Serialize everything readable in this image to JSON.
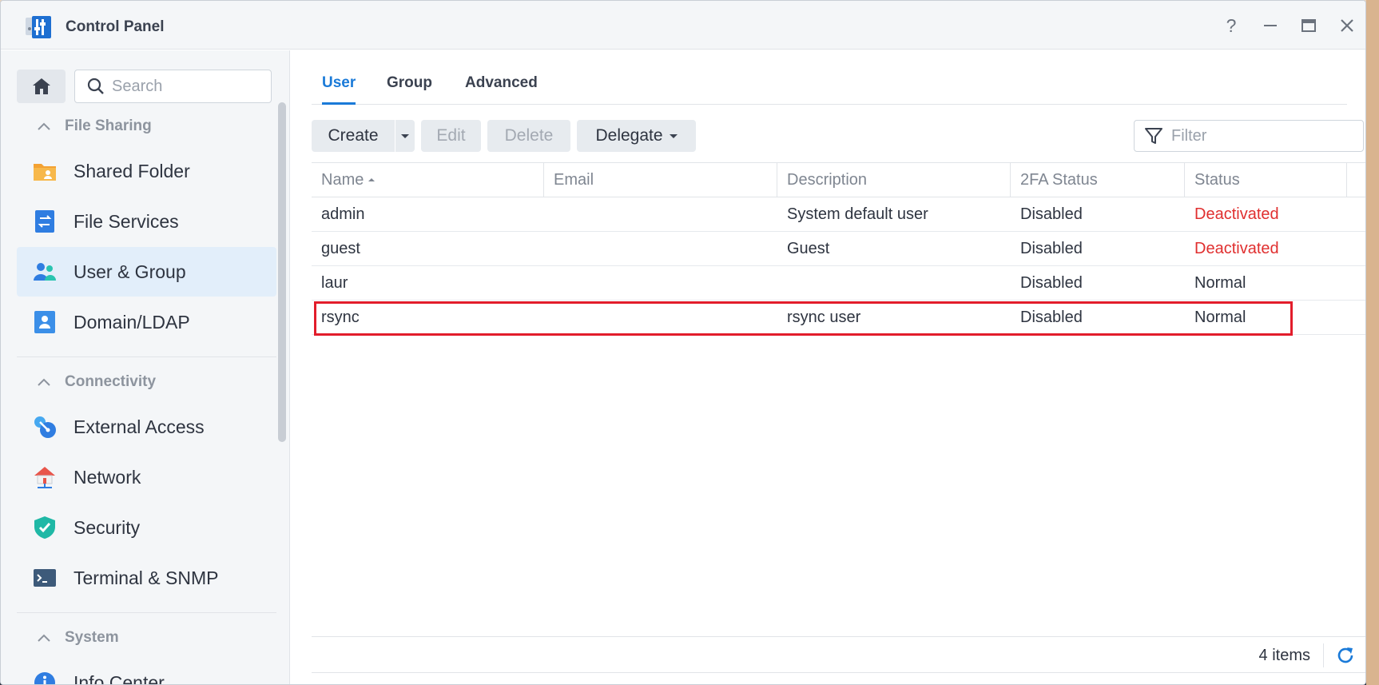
{
  "window": {
    "title": "Control Panel",
    "controls": [
      "help",
      "minimize",
      "maximize",
      "close"
    ]
  },
  "sidebar": {
    "search_placeholder": "Search",
    "sections": [
      {
        "title": "File Sharing",
        "items": [
          {
            "label": "Shared Folder",
            "icon": "folder-icon"
          },
          {
            "label": "File Services",
            "icon": "file-services-icon"
          },
          {
            "label": "User & Group",
            "icon": "users-icon",
            "active": true
          },
          {
            "label": "Domain/LDAP",
            "icon": "ldap-icon"
          }
        ]
      },
      {
        "title": "Connectivity",
        "items": [
          {
            "label": "External Access",
            "icon": "external-access-icon"
          },
          {
            "label": "Network",
            "icon": "network-icon"
          },
          {
            "label": "Security",
            "icon": "shield-icon"
          },
          {
            "label": "Terminal & SNMP",
            "icon": "terminal-icon"
          }
        ]
      },
      {
        "title": "System",
        "items": [
          {
            "label": "Info Center",
            "icon": "info-icon"
          }
        ]
      }
    ]
  },
  "main": {
    "tabs": [
      {
        "label": "User",
        "active": true
      },
      {
        "label": "Group"
      },
      {
        "label": "Advanced"
      }
    ],
    "toolbar": {
      "create": "Create",
      "edit": "Edit",
      "delete": "Delete",
      "delegate": "Delegate",
      "filter_placeholder": "Filter"
    },
    "table": {
      "columns": [
        "Name",
        "Email",
        "Description",
        "2FA Status",
        "Status"
      ],
      "sort_column": "Name",
      "rows": [
        {
          "name": "admin",
          "email": "",
          "description": "System default user",
          "twofa": "Disabled",
          "status": "Deactivated"
        },
        {
          "name": "guest",
          "email": "",
          "description": "Guest",
          "twofa": "Disabled",
          "status": "Deactivated"
        },
        {
          "name": "laur",
          "email": "",
          "description": "",
          "twofa": "Disabled",
          "status": "Normal"
        },
        {
          "name": "rsync",
          "email": "",
          "description": "rsync user",
          "twofa": "Disabled",
          "status": "Normal",
          "highlighted": true
        }
      ]
    },
    "footer": {
      "count": "4 items"
    }
  },
  "colors": {
    "accent": "#1a7ad8",
    "deactivated": "#e02f2f",
    "highlight_box": "#e21d2b",
    "sidebar_active": "#e2eefa"
  }
}
